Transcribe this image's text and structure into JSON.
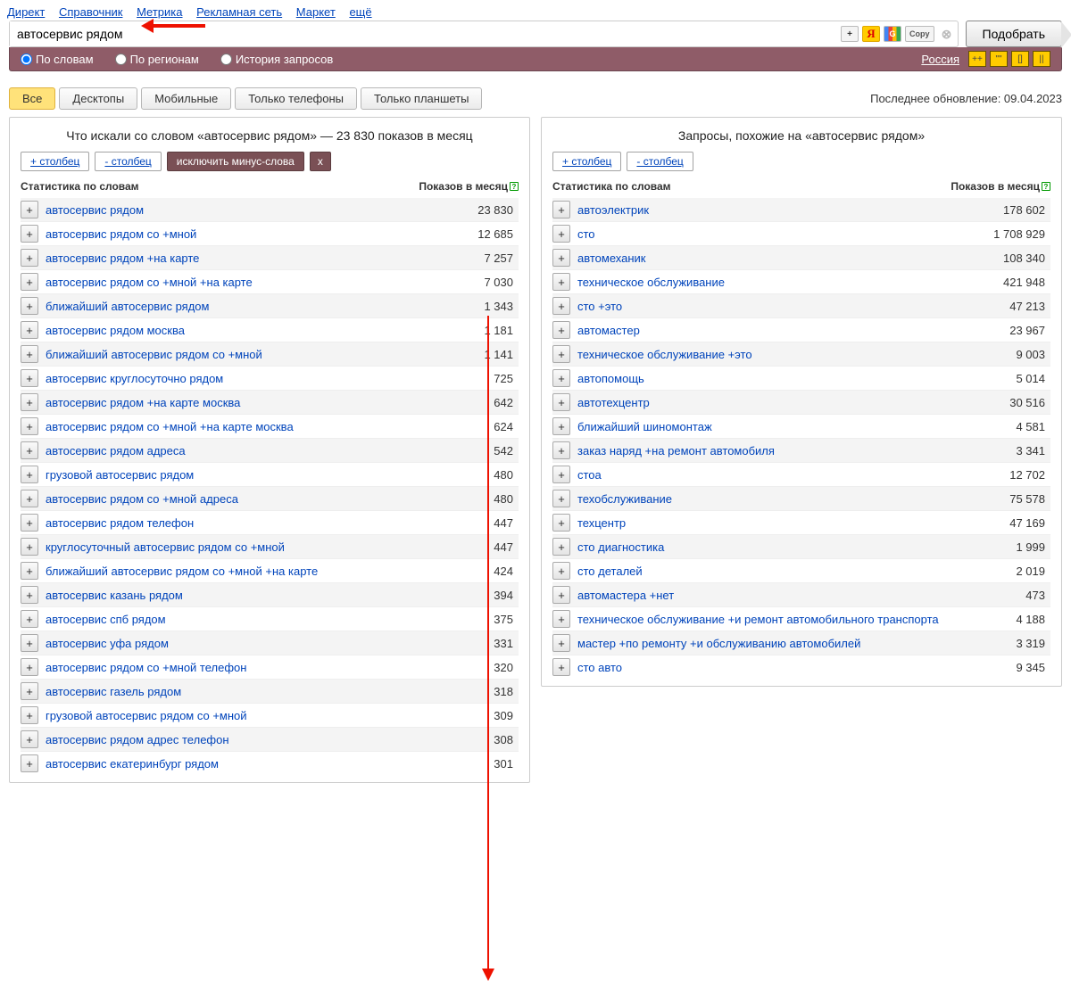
{
  "topnav": [
    "Директ",
    "Справочник",
    "Метрика",
    "Рекламная сеть",
    "Маркет",
    "ещё"
  ],
  "search_value": "автосервис рядом",
  "submit_label": "Подобрать",
  "sbtools": {
    "plus": "+",
    "y": "Я",
    "g": "G",
    "copy": "Copy",
    "clear": "⊗"
  },
  "modes": [
    {
      "label": "По словам",
      "checked": true
    },
    {
      "label": "По регионам",
      "checked": false
    },
    {
      "label": "История запросов",
      "checked": false
    }
  ],
  "region": "Россия",
  "ybtns": [
    "++",
    "\"\"",
    "[]",
    "||"
  ],
  "tabs": [
    "Все",
    "Десктопы",
    "Мобильные",
    "Только телефоны",
    "Только планшеты"
  ],
  "last_update": "Последнее обновление: 09.04.2023",
  "left": {
    "title": "Что искали со словом «автосервис рядом» — 23 830 показов в месяц",
    "addcol": "+ столбец",
    "remcol": "- столбец",
    "minus1": "исключить минус-слова",
    "minus2": "x",
    "h1": "Статистика по словам",
    "h2": "Показов в месяц",
    "rows": [
      {
        "k": "автосервис рядом",
        "v": "23 830"
      },
      {
        "k": "автосервис рядом со +мной",
        "v": "12 685"
      },
      {
        "k": "автосервис рядом +на карте",
        "v": "7 257"
      },
      {
        "k": "автосервис рядом со +мной +на карте",
        "v": "7 030"
      },
      {
        "k": "ближайший автосервис рядом",
        "v": "1 343"
      },
      {
        "k": "автосервис рядом москва",
        "v": "1 181"
      },
      {
        "k": "ближайший автосервис рядом со +мной",
        "v": "1 141"
      },
      {
        "k": "автосервис круглосуточно рядом",
        "v": "725"
      },
      {
        "k": "автосервис рядом +на карте москва",
        "v": "642"
      },
      {
        "k": "автосервис рядом со +мной +на карте москва",
        "v": "624"
      },
      {
        "k": "автосервис рядом адреса",
        "v": "542"
      },
      {
        "k": "грузовой автосервис рядом",
        "v": "480"
      },
      {
        "k": "автосервис рядом со +мной адреса",
        "v": "480"
      },
      {
        "k": "автосервис рядом телефон",
        "v": "447"
      },
      {
        "k": "круглосуточный автосервис рядом со +мной",
        "v": "447"
      },
      {
        "k": "ближайший автосервис рядом со +мной +на карте",
        "v": "424"
      },
      {
        "k": "автосервис казань рядом",
        "v": "394"
      },
      {
        "k": "автосервис спб рядом",
        "v": "375"
      },
      {
        "k": "автосервис уфа рядом",
        "v": "331"
      },
      {
        "k": "автосервис рядом со +мной телефон",
        "v": "320"
      },
      {
        "k": "автосервис газель рядом",
        "v": "318"
      },
      {
        "k": "грузовой автосервис рядом со +мной",
        "v": "309"
      },
      {
        "k": "автосервис рядом адрес телефон",
        "v": "308"
      },
      {
        "k": "автосервис екатеринбург рядом",
        "v": "301"
      }
    ]
  },
  "right": {
    "title": "Запросы, похожие на «автосервис рядом»",
    "addcol": "+ столбец",
    "remcol": "- столбец",
    "h1": "Статистика по словам",
    "h2": "Показов в месяц",
    "rows": [
      {
        "k": "автоэлектрик",
        "v": "178 602"
      },
      {
        "k": "сто",
        "v": "1 708 929"
      },
      {
        "k": "автомеханик",
        "v": "108 340"
      },
      {
        "k": "техническое обслуживание",
        "v": "421 948"
      },
      {
        "k": "сто +это",
        "v": "47 213"
      },
      {
        "k": "автомастер",
        "v": "23 967"
      },
      {
        "k": "техническое обслуживание +это",
        "v": "9 003"
      },
      {
        "k": "автопомощь",
        "v": "5 014"
      },
      {
        "k": "автотехцентр",
        "v": "30 516"
      },
      {
        "k": "ближайший шиномонтаж",
        "v": "4 581"
      },
      {
        "k": "заказ наряд +на ремонт автомобиля",
        "v": "3 341"
      },
      {
        "k": "стоа",
        "v": "12 702"
      },
      {
        "k": "техобслуживание",
        "v": "75 578"
      },
      {
        "k": "техцентр",
        "v": "47 169"
      },
      {
        "k": "сто диагностика",
        "v": "1 999"
      },
      {
        "k": "сто деталей",
        "v": "2 019"
      },
      {
        "k": "автомастера +нет",
        "v": "473"
      },
      {
        "k": "техническое обслуживание +и ремонт автомобильного транспорта",
        "v": "4 188"
      },
      {
        "k": "мастер +по ремонту +и обслуживанию автомобилей",
        "v": "3 319"
      },
      {
        "k": "сто авто",
        "v": "9 345"
      }
    ]
  }
}
